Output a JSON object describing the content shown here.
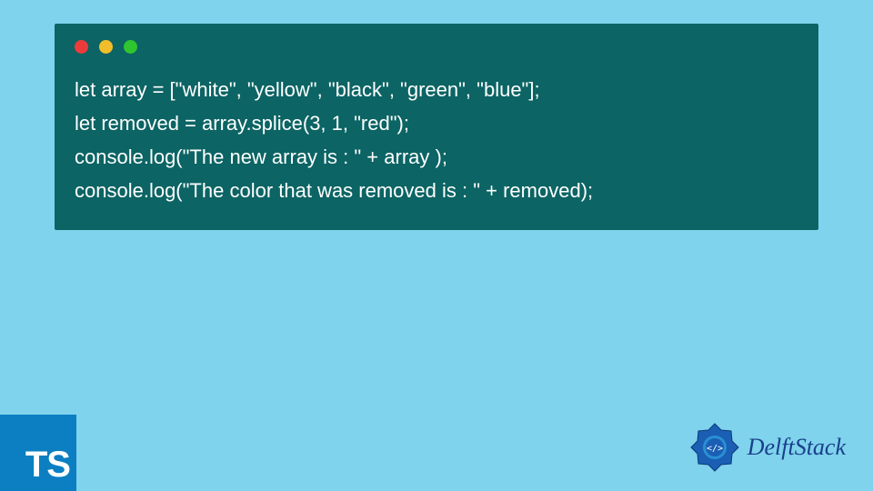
{
  "code": {
    "line1": "let array = [\"white\", \"yellow\", \"black\", \"green\", \"blue\"];",
    "line2": "let removed = array.splice(3, 1, \"red\");",
    "line3": "console.log(\"The new array is : \" + array );",
    "line4": "console.log(\"The color that was removed is : \" + removed);"
  },
  "badge": {
    "ts_label": "TS"
  },
  "brand": {
    "name": "DelftStack"
  },
  "colors": {
    "background": "#7fd3ed",
    "code_bg": "#0c6464",
    "ts_badge": "#0b7fc2",
    "brand_text": "#1a3f8b"
  }
}
